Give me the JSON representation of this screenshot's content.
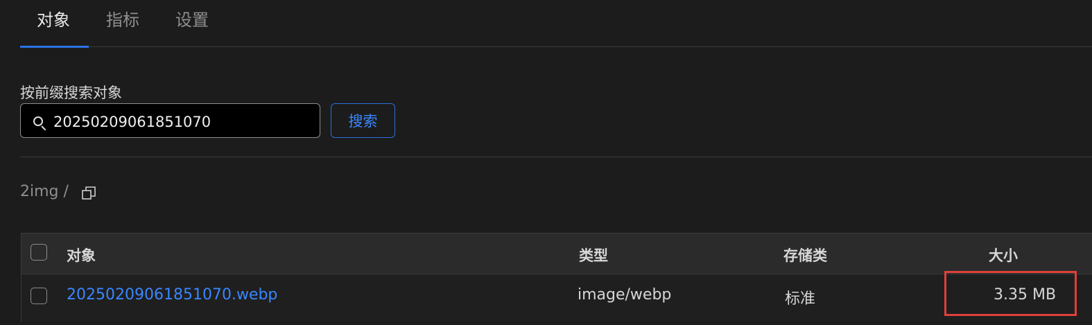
{
  "tabs": [
    {
      "label": "对象",
      "active": true
    },
    {
      "label": "指标",
      "active": false
    },
    {
      "label": "设置",
      "active": false
    }
  ],
  "search": {
    "label": "按前缀搜索对象",
    "value": "20250209061851070",
    "button_label": "搜索"
  },
  "breadcrumb": {
    "path": "2img /",
    "copy_icon": "copy-icon"
  },
  "table": {
    "columns": [
      "对象",
      "类型",
      "存储类",
      "大小"
    ],
    "rows": [
      {
        "name": "20250209061851070.webp",
        "type": "image/webp",
        "storage_class": "标准",
        "size": "3.35 MB"
      }
    ]
  },
  "colors": {
    "accent": "#2b73e6",
    "link": "#3a86ff",
    "highlight": "#e0403a",
    "background": "#1c1c1c"
  }
}
